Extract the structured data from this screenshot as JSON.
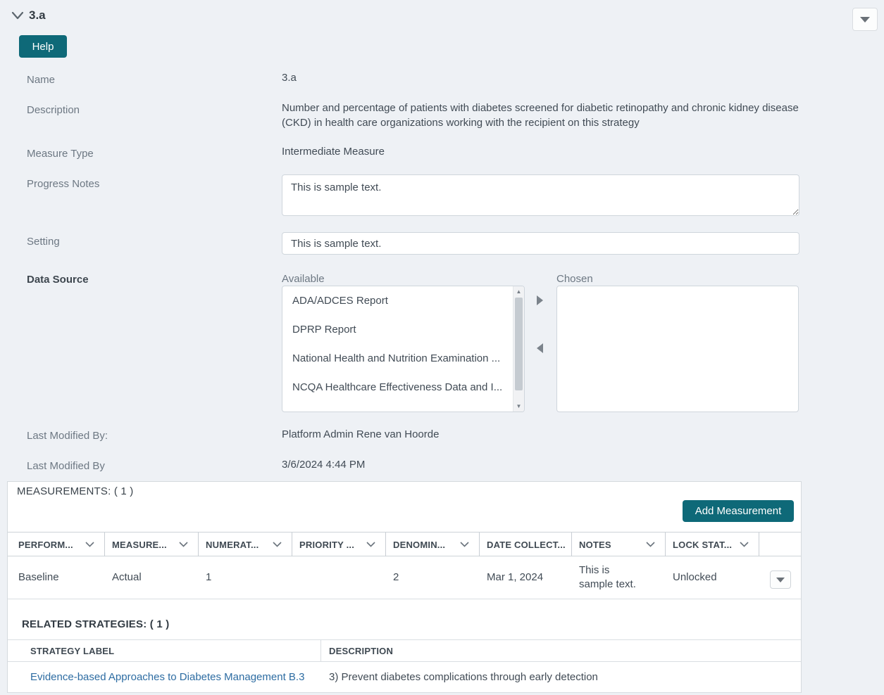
{
  "colors": {
    "accent_teal": "#0e6978",
    "link_blue": "#2d6ca2",
    "page_bg": "#eef1f5"
  },
  "icons": {
    "collapse": "chevron-down",
    "header_menu": "caret-down",
    "column_menu": "chevron-down",
    "row_menu": "caret-down",
    "move_right": "triangle-right",
    "move_left": "triangle-left",
    "scroll_up": "triangle-up",
    "scroll_down": "triangle-down"
  },
  "header": {
    "title": "3.a"
  },
  "buttons": {
    "help": "Help",
    "add_measurement": "Add Measurement"
  },
  "fields": {
    "name": {
      "label": "Name",
      "value": "3.a"
    },
    "description": {
      "label": "Description",
      "value": "Number and percentage of patients with diabetes screened for diabetic retinopathy and chronic kidney disease (CKD) in health care organizations working with the recipient on this strategy"
    },
    "measure_type": {
      "label": "Measure Type",
      "value": "Intermediate Measure"
    },
    "progress_notes": {
      "label": "Progress Notes",
      "value": "This is sample text."
    },
    "setting": {
      "label": "Setting",
      "value": "This is sample text."
    },
    "data_source": {
      "label": "Data Source",
      "available_label": "Available",
      "chosen_label": "Chosen",
      "available_items": [
        "ADA/ADCES Report",
        "DPRP Report",
        "National Health and Nutrition Examination ...",
        "NCQA Healthcare Effectiveness Data and I..."
      ],
      "chosen_items": []
    },
    "last_modified_by_name": {
      "label": "Last Modified By:",
      "value": "Platform Admin Rene van Hoorde"
    },
    "last_modified_by_date": {
      "label": "Last Modified By",
      "value": "3/6/2024 4:44 PM"
    }
  },
  "measurements": {
    "title": "MEASUREMENTS: ( 1 )",
    "columns": [
      {
        "label": "PERFORM...",
        "menu": true
      },
      {
        "label": "MEASURE...",
        "menu": true
      },
      {
        "label": "NUMERAT...",
        "menu": true
      },
      {
        "label": "PRIORITY ...",
        "menu": true
      },
      {
        "label": "DENOMIN...",
        "menu": true
      },
      {
        "label": "DATE COLLECT...",
        "menu": false
      },
      {
        "label": "NOTES",
        "menu": true
      },
      {
        "label": "LOCK STAT...",
        "menu": true
      }
    ],
    "rows": [
      [
        "Baseline",
        "Actual",
        "1",
        "",
        "2",
        "Mar 1, 2024",
        "This is sample text.",
        "Unlocked"
      ]
    ]
  },
  "related_strategies": {
    "title": "RELATED STRATEGIES: ( 1 )",
    "columns": [
      "STRATEGY LABEL",
      "DESCRIPTION"
    ],
    "rows": [
      {
        "label": "Evidence-based Approaches to Diabetes Management B.3",
        "description": "3) Prevent diabetes complications through early detection"
      }
    ]
  }
}
